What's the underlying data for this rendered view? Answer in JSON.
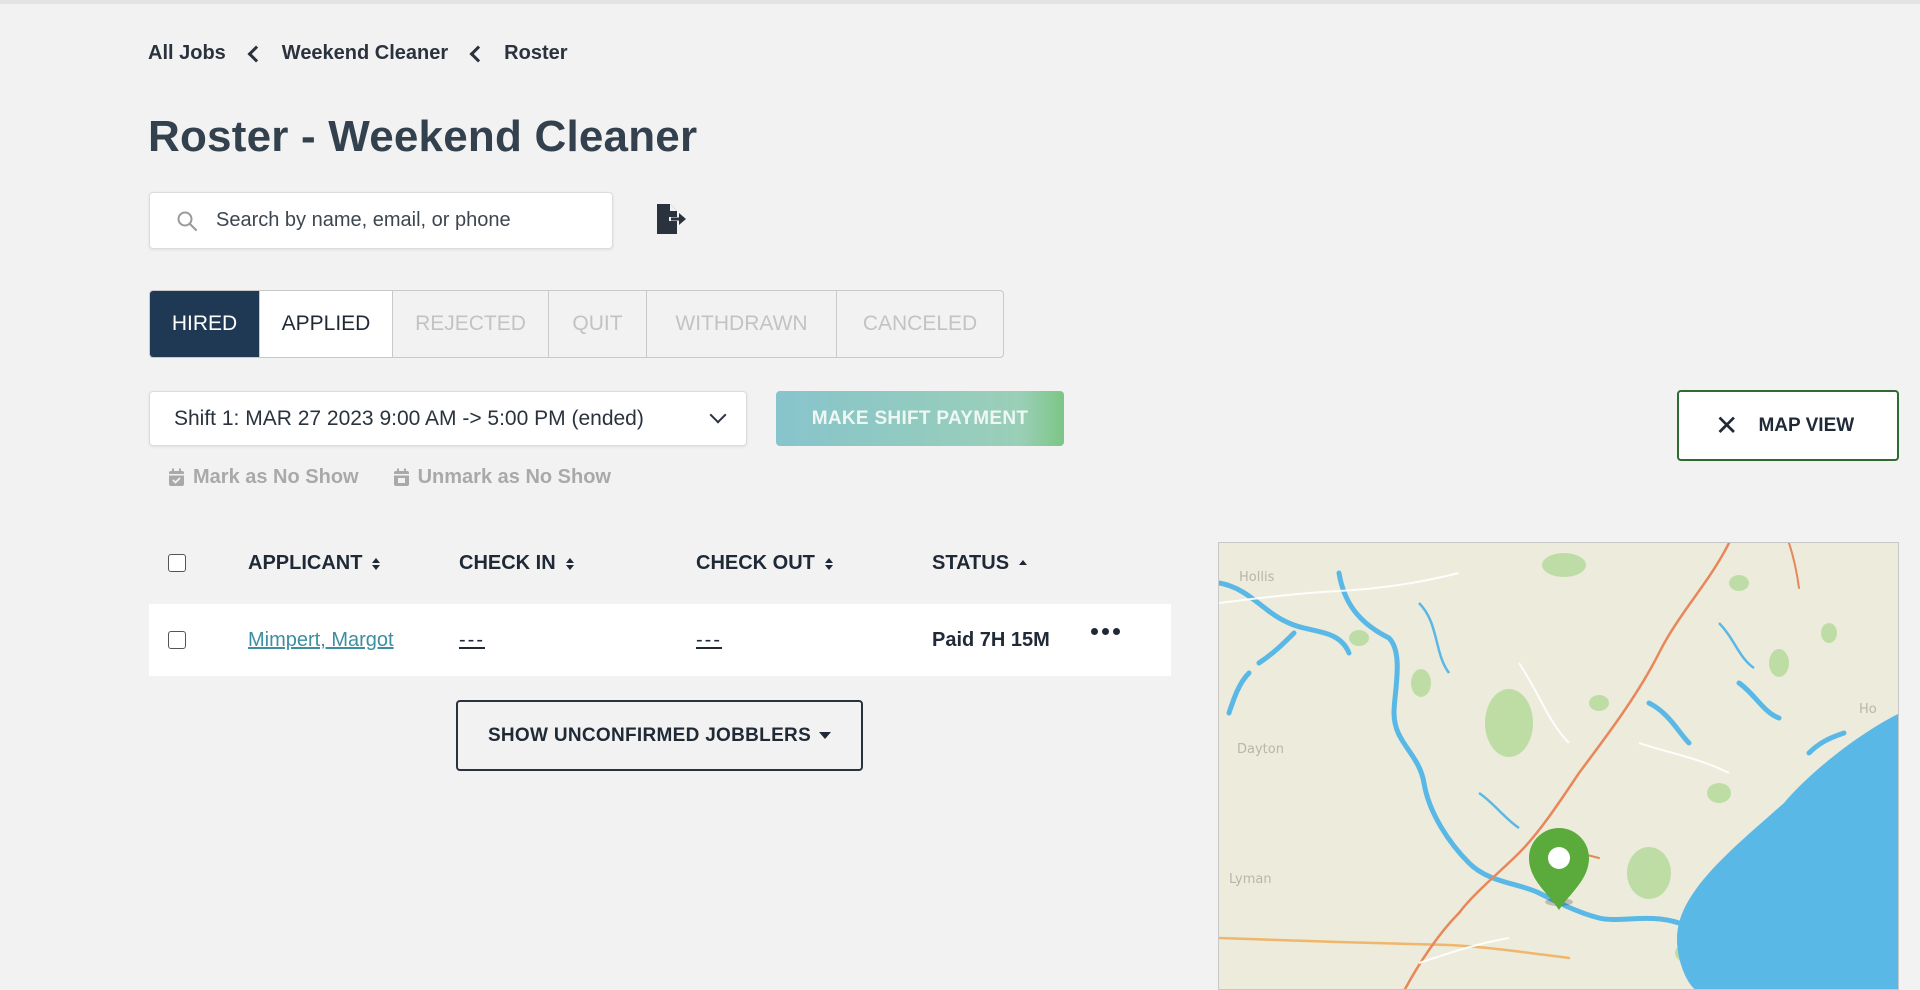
{
  "breadcrumb": {
    "items": [
      "All Jobs",
      "Weekend Cleaner",
      "Roster"
    ]
  },
  "page": {
    "title": "Roster - Weekend Cleaner"
  },
  "search": {
    "placeholder": "Search by name, email, or phone",
    "value": ""
  },
  "icons": {
    "search": "search-icon",
    "export": "file-export-icon",
    "calendar": "calendar-check-icon",
    "close": "close-icon",
    "more": "more-horizontal-icon",
    "map_pin": "map-pin-icon"
  },
  "tabs": [
    {
      "label": "HIRED",
      "state": "active"
    },
    {
      "label": "APPLIED",
      "state": "selected"
    },
    {
      "label": "REJECTED",
      "state": "disabled"
    },
    {
      "label": "QUIT",
      "state": "disabled"
    },
    {
      "label": "WITHDRAWN",
      "state": "disabled"
    },
    {
      "label": "CANCELED",
      "state": "disabled"
    }
  ],
  "shift": {
    "selected": "Shift 1: MAR 27 2023 9:00 AM -> 5:00 PM (ended)"
  },
  "buttons": {
    "make_shift_payment": "MAKE SHIFT PAYMENT",
    "map_view": "MAP VIEW",
    "show_unconfirmed": "SHOW UNCONFIRMED JOBBLERS"
  },
  "actions": {
    "mark_no_show": "Mark as No Show",
    "unmark_no_show": "Unmark as No Show"
  },
  "table": {
    "columns": [
      "APPLICANT",
      "CHECK IN",
      "CHECK OUT",
      "STATUS"
    ],
    "rows": [
      {
        "applicant": "Mimpert, Margot",
        "check_in": "---",
        "check_out": "---",
        "status": "Paid 7H 15M"
      }
    ]
  },
  "colors": {
    "primary_dark": "#1f3854",
    "map_water": "#5ab8e6",
    "map_pin": "#5aaa3c",
    "map_view_border": "#2e6b33",
    "link": "#3c8ea0"
  }
}
